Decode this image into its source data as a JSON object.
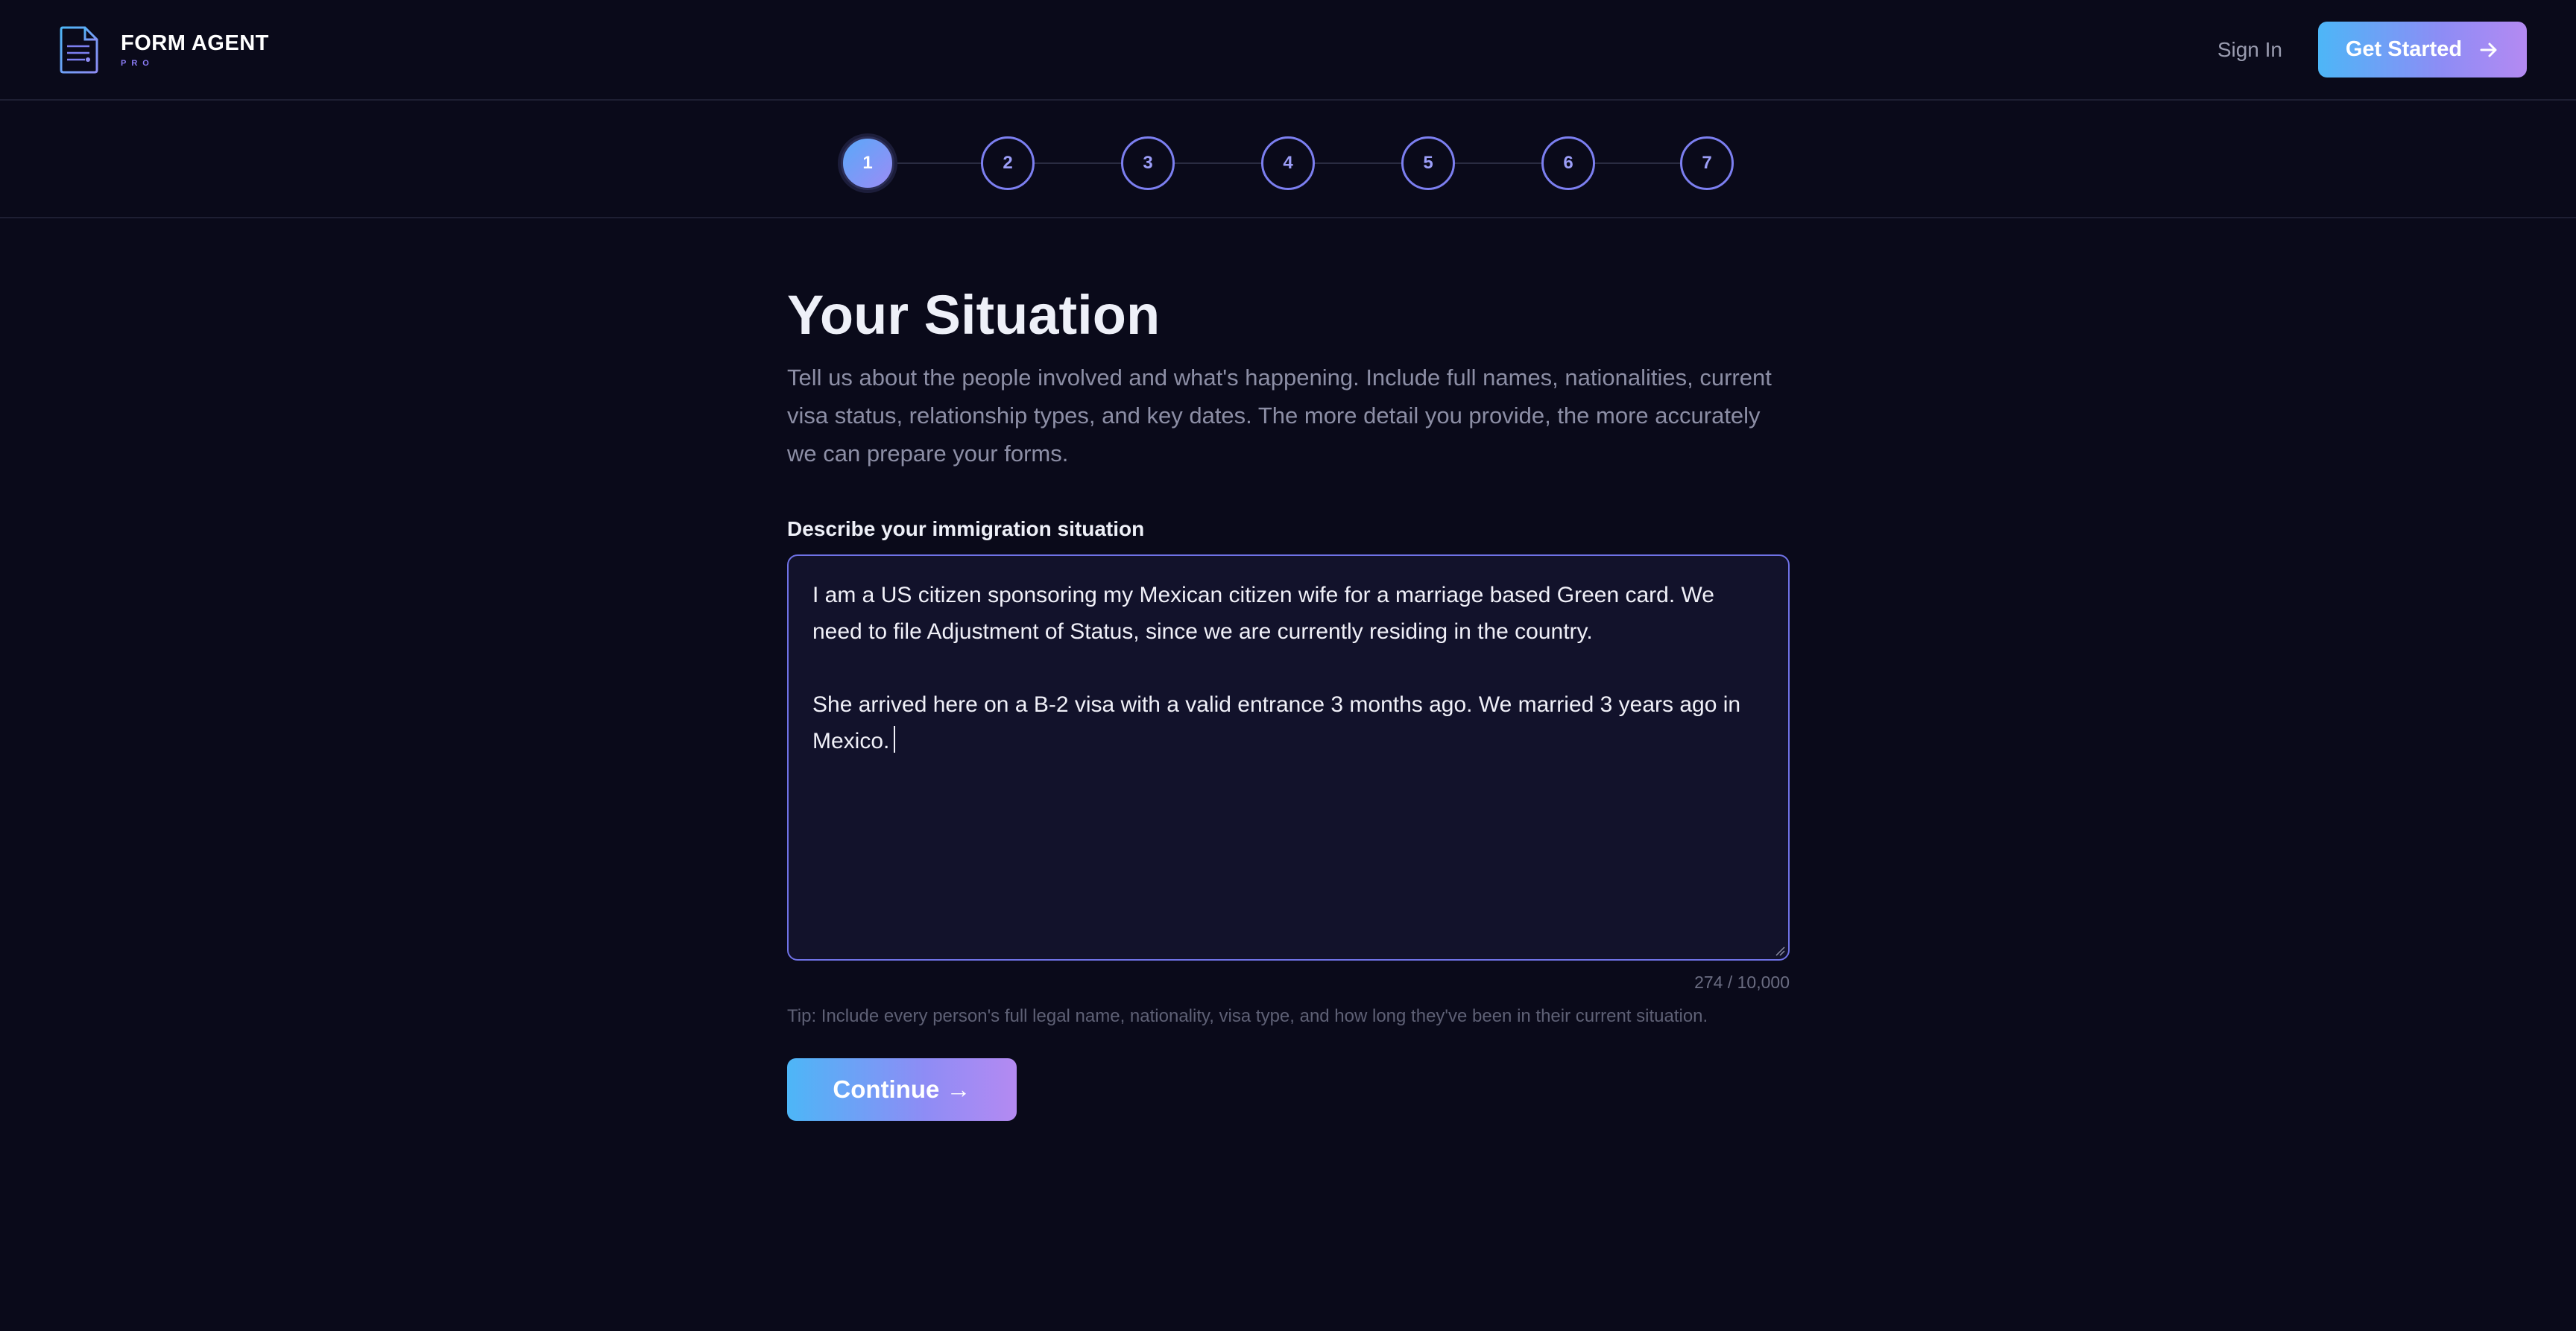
{
  "brand": {
    "name": "FORM AGENT",
    "sub": "PRO"
  },
  "header": {
    "sign_in": "Sign In",
    "get_started": "Get Started"
  },
  "stepper": {
    "steps": [
      "1",
      "2",
      "3",
      "4",
      "5",
      "6",
      "7"
    ],
    "active_step": 1
  },
  "main": {
    "title": "Your Situation",
    "description": "Tell us about the people involved and what's happening. Include full names, nationalities, current visa status, relationship types, and key dates. The more detail you provide, the more accurately we can prepare your forms.",
    "field_label": "Describe your immigration situation",
    "situation_text": "I am a US citizen sponsoring my Mexican citizen wife for a marriage based Green card. We need to file Adjustment of Status, since we are currently residing in the country.\n\nShe arrived here on a B-2 visa with a valid entrance 3 months ago. We married 3 years ago in Mexico.",
    "char_count": "274 / 10,000",
    "tip": "Tip: Include every person's full legal name, nationality, visa type, and how long they've been in their current situation.",
    "continue_label": "Continue →"
  },
  "colors": {
    "background": "#0a0a1a",
    "accent_start": "#4db6f7",
    "accent_end": "#b48af2",
    "step_border": "#7c7ff0"
  },
  "icons": {
    "brand": "document-form-icon",
    "get_started": "arrow-right-icon"
  }
}
